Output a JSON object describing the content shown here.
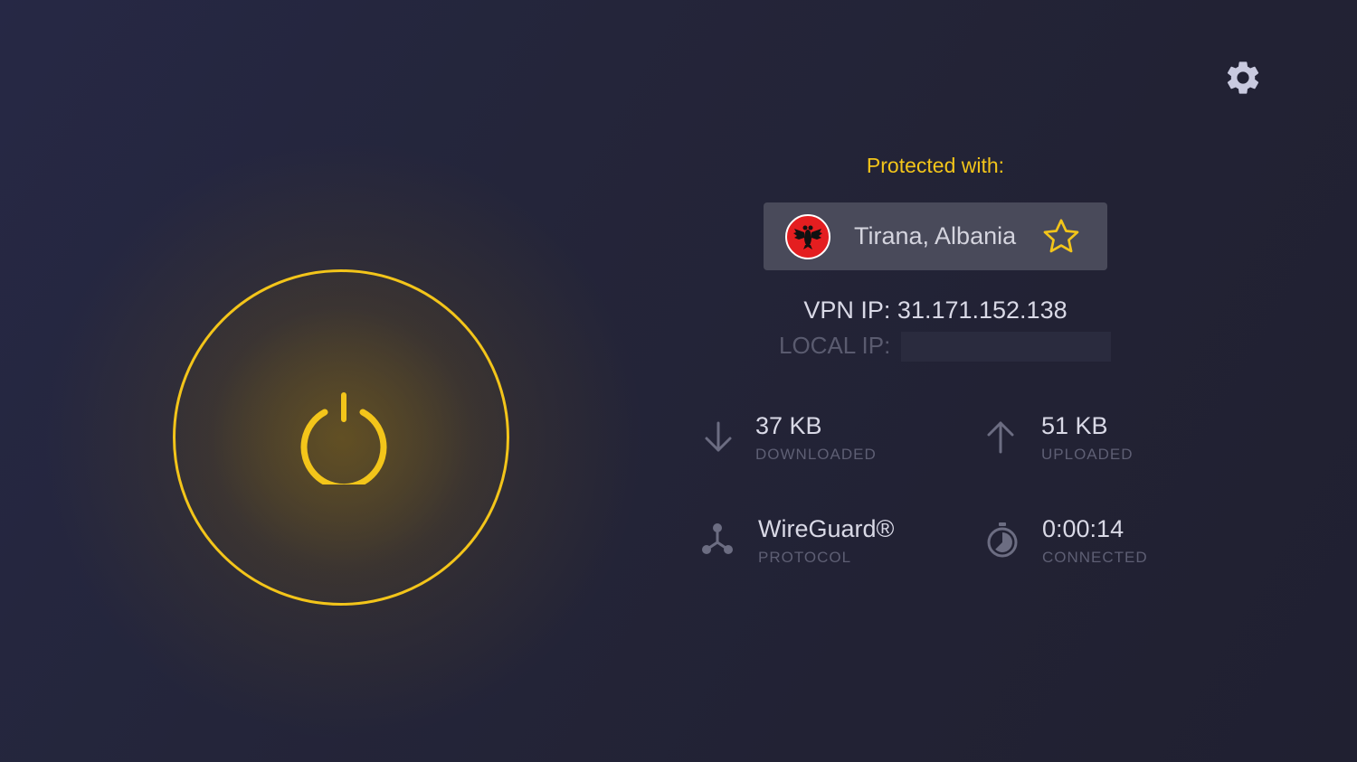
{
  "header": {
    "settings_icon": "gear-icon"
  },
  "power": {
    "icon": "power-icon",
    "accent_color": "#f3c51a"
  },
  "connection": {
    "protected_label": "Protected with:",
    "location": "Tirana, Albania",
    "flag_icon": "albania-flag-icon",
    "favorite_icon": "star-outline-icon",
    "vpn_ip_label": "VPN IP:",
    "vpn_ip": "31.171.152.138",
    "vpn_ip_text": "VPN IP:  31.171.152.138",
    "local_ip_label": "LOCAL IP:"
  },
  "stats": {
    "downloaded": {
      "value": "37 KB",
      "label": "DOWNLOADED",
      "icon": "arrow-down-icon"
    },
    "uploaded": {
      "value": "51 KB",
      "label": "UPLOADED",
      "icon": "arrow-up-icon"
    },
    "protocol": {
      "value": "WireGuard®",
      "label": "PROTOCOL",
      "icon": "protocol-network-icon"
    },
    "connected": {
      "value": "0:00:14",
      "label": "CONNECTED",
      "icon": "timer-icon"
    }
  }
}
